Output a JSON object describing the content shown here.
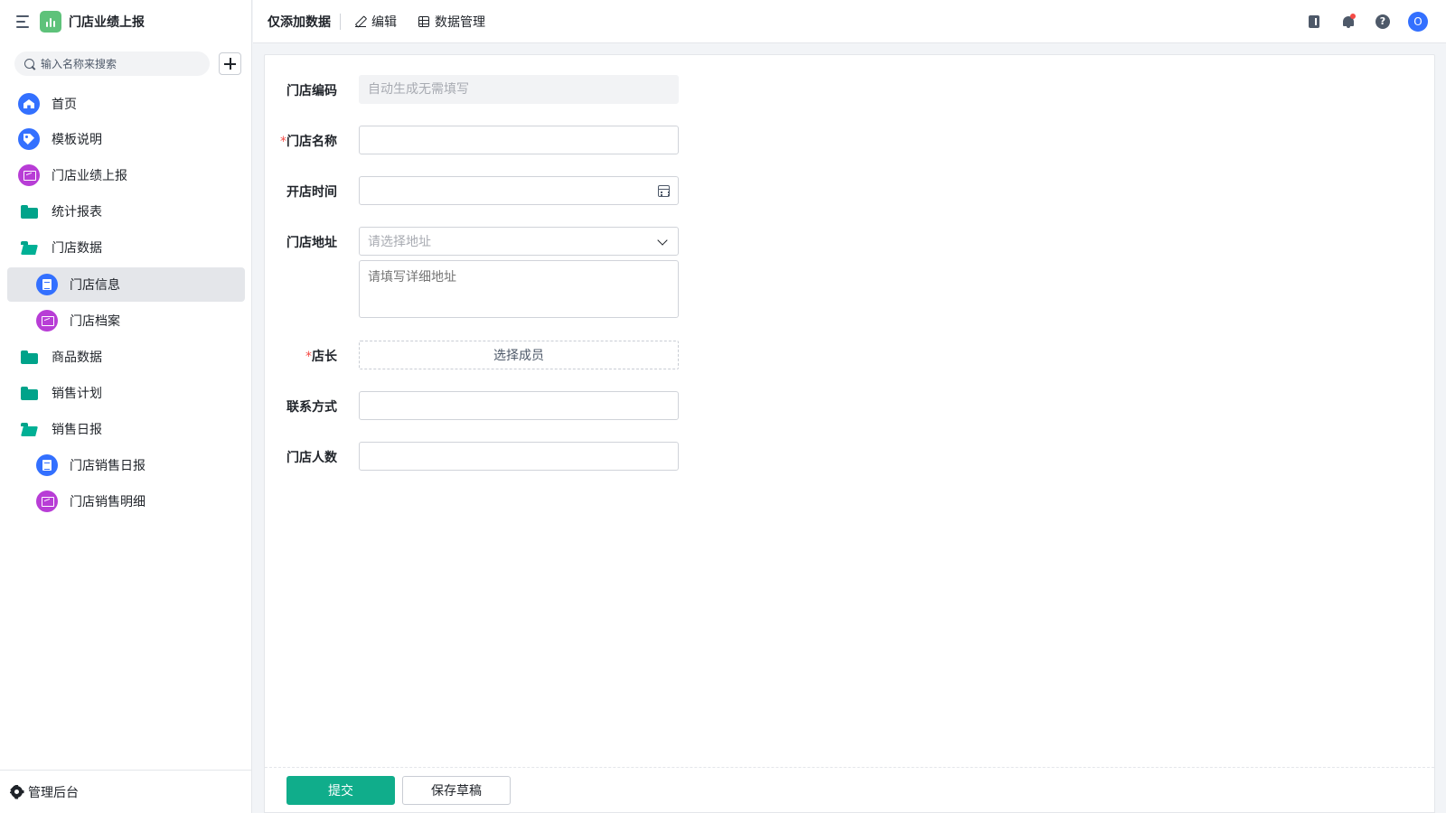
{
  "app": {
    "title": "门店业绩上报",
    "brand_color": "#5ec27a",
    "accent_color": "#10ad8b"
  },
  "sidebar": {
    "search_placeholder": "输入名称来搜索",
    "items": [
      {
        "label": "首页",
        "icon": "home-icon"
      },
      {
        "label": "模板说明",
        "icon": "tag-icon"
      },
      {
        "label": "门店业绩上报",
        "icon": "dashboard-icon"
      },
      {
        "label": "统计报表",
        "icon": "folder-icon"
      },
      {
        "label": "门店数据",
        "icon": "folder-open-icon"
      },
      {
        "label": "门店信息",
        "icon": "form-doc-icon",
        "active": true
      },
      {
        "label": "门店档案",
        "icon": "dashboard-icon"
      },
      {
        "label": "商品数据",
        "icon": "folder-icon"
      },
      {
        "label": "销售计划",
        "icon": "folder-icon"
      },
      {
        "label": "销售日报",
        "icon": "folder-open-icon"
      },
      {
        "label": "门店销售日报",
        "icon": "form-doc-icon"
      },
      {
        "label": "门店销售明细",
        "icon": "dashboard-icon"
      }
    ],
    "footer_label": "管理后台"
  },
  "topbar": {
    "title": "仅添加数据",
    "tabs": [
      {
        "label": "编辑",
        "icon": "edit-icon"
      },
      {
        "label": "数据管理",
        "icon": "table-icon"
      }
    ],
    "avatar_initial": "O",
    "help_glyph": "?"
  },
  "form": {
    "fields": [
      {
        "label": "门店编码",
        "required": false,
        "placeholder": "自动生成无需填写",
        "disabled": true
      },
      {
        "label": "门店名称",
        "required": true,
        "value": ""
      },
      {
        "label": "开店时间",
        "required": false,
        "value": ""
      },
      {
        "label": "门店地址",
        "required": false,
        "select_placeholder": "请选择地址",
        "detail_placeholder": "请填写详细地址"
      },
      {
        "label": "店长",
        "required": true,
        "picker_label": "选择成员"
      },
      {
        "label": "联系方式",
        "required": false,
        "value": ""
      },
      {
        "label": "门店人数",
        "required": false,
        "value": ""
      }
    ],
    "required_mark": "*",
    "submit_label": "提交",
    "draft_label": "保存草稿"
  }
}
